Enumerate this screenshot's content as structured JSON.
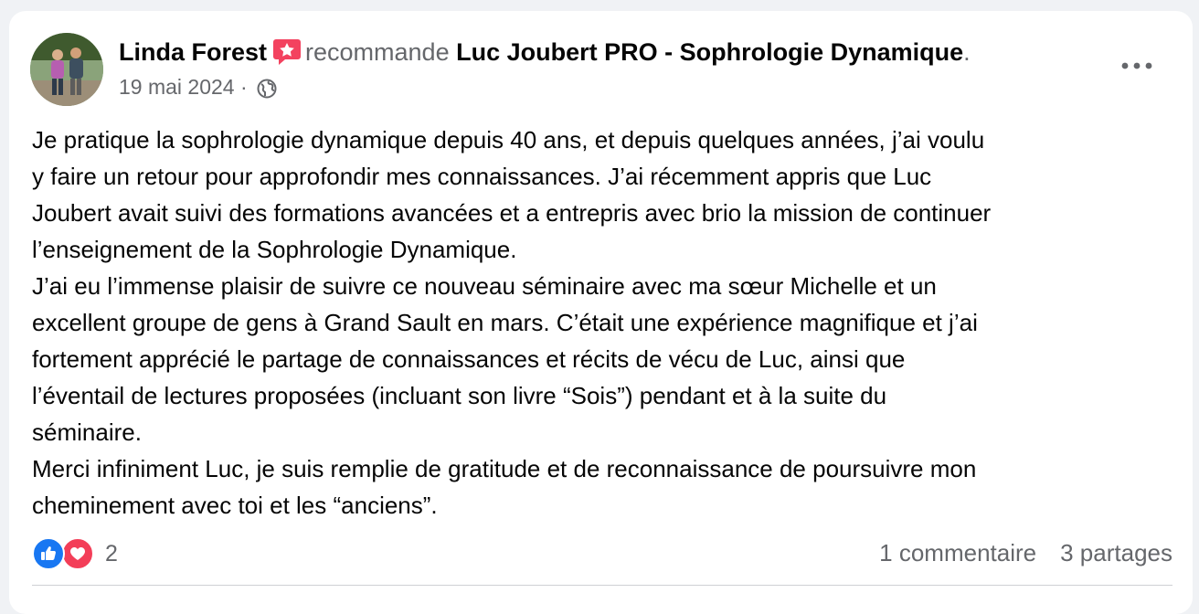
{
  "post": {
    "author": "Linda Forest",
    "verb": "recommande",
    "page": "Luc Joubert PRO - Sophrologie Dynamique",
    "end_punct": ".",
    "date": "19 mai 2024",
    "separator": "·",
    "visibility_icon": "globe-icon",
    "recommend_icon": "recommend-star-icon",
    "more_icon": "more-dots-icon",
    "body_lines": [
      "Je pratique la sophrologie dynamique depuis 40 ans, et depuis quelques années, j’ai voulu",
      "y faire un retour pour approfondir mes connaissances. J’ai récemment appris que Luc",
      "Joubert avait suivi des formations avancées et a entrepris avec brio la mission de continuer",
      "l’enseignement  de la Sophrologie Dynamique.",
      "J’ai eu l’immense plaisir de suivre ce nouveau séminaire avec ma sœur Michelle et un",
      "excellent groupe de gens à Grand Sault en mars. C’était une  expérience magnifique et j’ai",
      "fortement apprécié le partage de connaissances et  récits de vécu de Luc, ainsi que",
      "l’éventail de lectures proposées (incluant son livre “Sois”) pendant et à la suite du",
      "séminaire.",
      "Merci infiniment Luc, je suis remplie de gratitude et de reconnaissance de poursuivre mon",
      "cheminement avec toi et les “anciens”."
    ]
  },
  "footer": {
    "reaction_icons": [
      "like-icon",
      "love-icon"
    ],
    "reaction_count": "2",
    "comments": "1 commentaire",
    "shares": "3 partages"
  },
  "colors": {
    "background": "#f0f2f5",
    "card": "#ffffff",
    "text": "#050505",
    "secondary_text": "#65676b",
    "like_blue": "#1877f2",
    "love_red": "#f33e58",
    "recommend_pink": "#f3425f"
  }
}
